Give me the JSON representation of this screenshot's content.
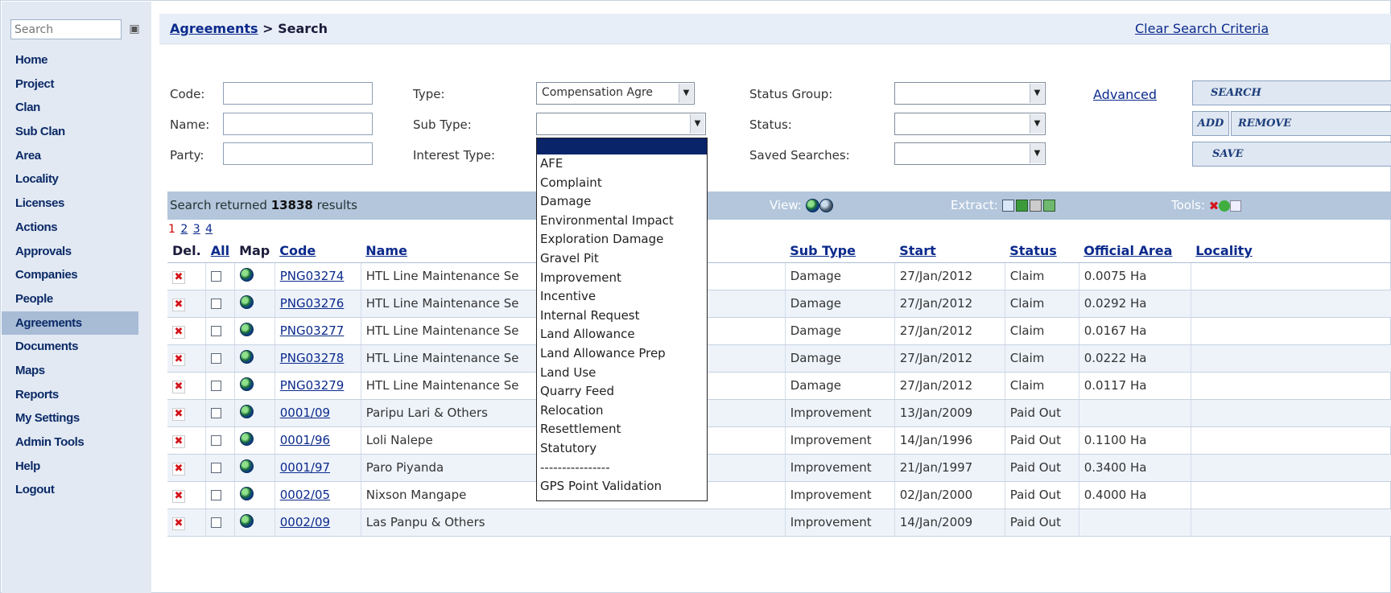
{
  "sidebar": {
    "search_placeholder": "Search",
    "items": [
      "Home",
      "Project",
      "Clan",
      "Sub Clan",
      "Area",
      "Locality",
      "Licenses",
      "Actions",
      "Approvals",
      "Companies",
      "People",
      "Agreements",
      "Documents",
      "Maps",
      "Reports",
      "My Settings",
      "Admin Tools",
      "Help",
      "Logout"
    ],
    "active": "Agreements"
  },
  "breadcrumb": {
    "parent": "Agreements",
    "separator": " > ",
    "current": "Search"
  },
  "clear_search": "Clear Search Criteria",
  "form": {
    "code_label": "Code:",
    "name_label": "Name:",
    "party_label": "Party:",
    "type_label": "Type:",
    "type_value": "Compensation Agre",
    "subtype_label": "Sub Type:",
    "interest_label": "Interest Type:",
    "status_group_label": "Status Group:",
    "status_label": "Status:",
    "saved_label": "Saved Searches:",
    "advanced": "Advanced",
    "buttons": {
      "search": "SEARCH",
      "add": "ADD",
      "remove": "REMOVE",
      "save": "SAVE"
    }
  },
  "results": {
    "prefix": "Search returned ",
    "count": "13838",
    "suffix": " results",
    "view": "View:",
    "extract": "Extract:",
    "tools": "Tools:",
    "pages": [
      "1",
      "2",
      "3",
      "4"
    ]
  },
  "table": {
    "headers": {
      "del": "Del.",
      "all": "All",
      "map": "Map",
      "code": "Code",
      "name": "Name",
      "subtype": "Sub Type",
      "start": "Start",
      "status": "Status",
      "area": "Official Area",
      "locality": "Locality"
    },
    "rows": [
      {
        "code": "PNG03274",
        "name": "HTL Line Maintenance Se",
        "subtype": "Damage",
        "start": "27/Jan/2012",
        "status": "Claim",
        "area": "0.0075 Ha"
      },
      {
        "code": "PNG03276",
        "name": "HTL Line Maintenance Se",
        "subtype": "Damage",
        "start": "27/Jan/2012",
        "status": "Claim",
        "area": "0.0292 Ha"
      },
      {
        "code": "PNG03277",
        "name": "HTL Line Maintenance Se",
        "subtype": "Damage",
        "start": "27/Jan/2012",
        "status": "Claim",
        "area": "0.0167 Ha"
      },
      {
        "code": "PNG03278",
        "name": "HTL Line Maintenance Se",
        "subtype": "Damage",
        "start": "27/Jan/2012",
        "status": "Claim",
        "area": "0.0222 Ha"
      },
      {
        "code": "PNG03279",
        "name": "HTL Line Maintenance Se",
        "subtype": "Damage",
        "start": "27/Jan/2012",
        "status": "Claim",
        "area": "0.0117 Ha"
      },
      {
        "code": "0001/09",
        "name": "Paripu Lari & Others",
        "subtype": "Improvement",
        "start": "13/Jan/2009",
        "status": "Paid Out",
        "area": ""
      },
      {
        "code": "0001/96",
        "name": "Loli Nalepe",
        "subtype": "Improvement",
        "start": "14/Jan/1996",
        "status": "Paid Out",
        "area": "0.1100 Ha"
      },
      {
        "code": "0001/97",
        "name": "Paro Piyanda",
        "subtype": "Improvement",
        "start": "21/Jan/1997",
        "status": "Paid Out",
        "area": "0.3400 Ha"
      },
      {
        "code": "0002/05",
        "name": "Nixson Mangape",
        "subtype": "Improvement",
        "start": "02/Jan/2000",
        "status": "Paid Out",
        "area": "0.4000 Ha"
      },
      {
        "code": "0002/09",
        "name": "Las Panpu & Others",
        "subtype": "Improvement",
        "start": "14/Jan/2009",
        "status": "Paid Out",
        "area": ""
      }
    ]
  },
  "dropdown_options": [
    "",
    "AFE",
    "Complaint",
    "Damage",
    "Environmental Impact",
    "Exploration Damage",
    "Gravel Pit",
    "Improvement",
    "Incentive",
    "Internal Request",
    "Land Allowance",
    "Land Allowance Prep",
    "Land Use",
    "Quarry Feed",
    "Relocation",
    "Resettlement",
    "Statutory",
    "----------------",
    "GPS Point Validation"
  ],
  "colors": {
    "sidebar_bg": "#e2e9f3",
    "active_nav": "#a8bcd6",
    "result_bar": "#b3c6dc",
    "link": "#0b2a8c",
    "dropdown_selected": "#0a246a"
  }
}
